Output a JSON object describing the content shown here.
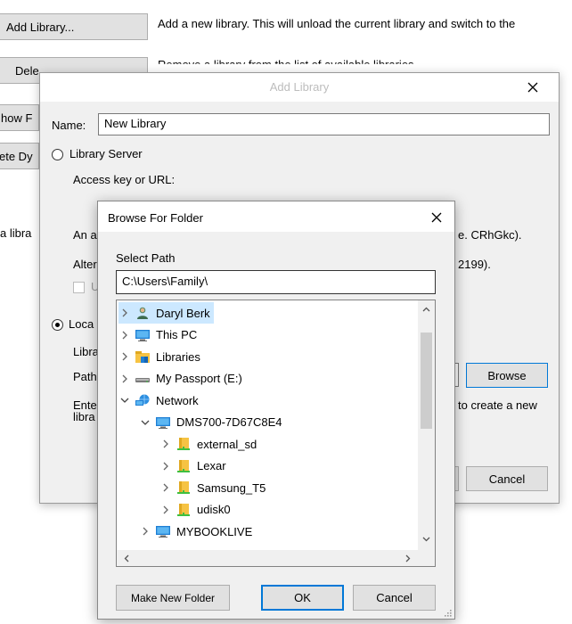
{
  "background": {
    "add_library_button": "Add Library...",
    "add_library_desc": "Add a new library.  This will unload the current library and switch to the",
    "delete_button": "Dele",
    "delete_desc": "Remove a library from the list of available libraries.",
    "show_button": "how F",
    "delete_dy_button": "ete Dy",
    "left_text": "a libra"
  },
  "add_library_dialog": {
    "title": "Add Library",
    "name_label": "Name:",
    "name_value": "New Library",
    "library_server_label": "Library Server",
    "access_key_label": "Access key or URL:",
    "partial_an": "An a",
    "partial_an_right": "e. CRhGkc).",
    "partial_alter": "Alter",
    "partial_alter_right": "2199).",
    "partial_u": "U",
    "local_label": "Loca",
    "library_label": "Libra",
    "path_label": "Path",
    "browse_button": "Browse",
    "enter_label": "Ente",
    "libra2_label": "libra",
    "enter_right": "to create a new",
    "cancel_button": "Cancel"
  },
  "browse_dialog": {
    "title": "Browse For Folder",
    "select_path_label": "Select Path",
    "path_value": "C:\\Users\\Family\\",
    "make_new_folder_button": "Make New Folder",
    "ok_button": "OK",
    "cancel_button": "Cancel",
    "tree": [
      {
        "label": "Daryl Berk",
        "icon": "user-icon",
        "level": 0,
        "expanded": false,
        "selected": true
      },
      {
        "label": "This PC",
        "icon": "computer-icon",
        "level": 0,
        "expanded": false,
        "selected": false
      },
      {
        "label": "Libraries",
        "icon": "libraries-icon",
        "level": 0,
        "expanded": false,
        "selected": false
      },
      {
        "label": "My Passport (E:)",
        "icon": "drive-icon",
        "level": 0,
        "expanded": false,
        "selected": false
      },
      {
        "label": "Network",
        "icon": "network-icon",
        "level": 0,
        "expanded": true,
        "selected": false
      },
      {
        "label": "DMS700-7D67C8E4",
        "icon": "computer-icon",
        "level": 1,
        "expanded": true,
        "selected": false
      },
      {
        "label": "external_sd",
        "icon": "share-folder-icon",
        "level": 2,
        "expanded": false,
        "selected": false
      },
      {
        "label": "Lexar",
        "icon": "share-folder-icon",
        "level": 2,
        "expanded": false,
        "selected": false
      },
      {
        "label": "Samsung_T5",
        "icon": "share-folder-icon",
        "level": 2,
        "expanded": false,
        "selected": false
      },
      {
        "label": "udisk0",
        "icon": "share-folder-icon",
        "level": 2,
        "expanded": false,
        "selected": false
      },
      {
        "label": "MYBOOKLIVE",
        "icon": "computer-icon",
        "level": 1,
        "expanded": false,
        "selected": false
      }
    ]
  }
}
